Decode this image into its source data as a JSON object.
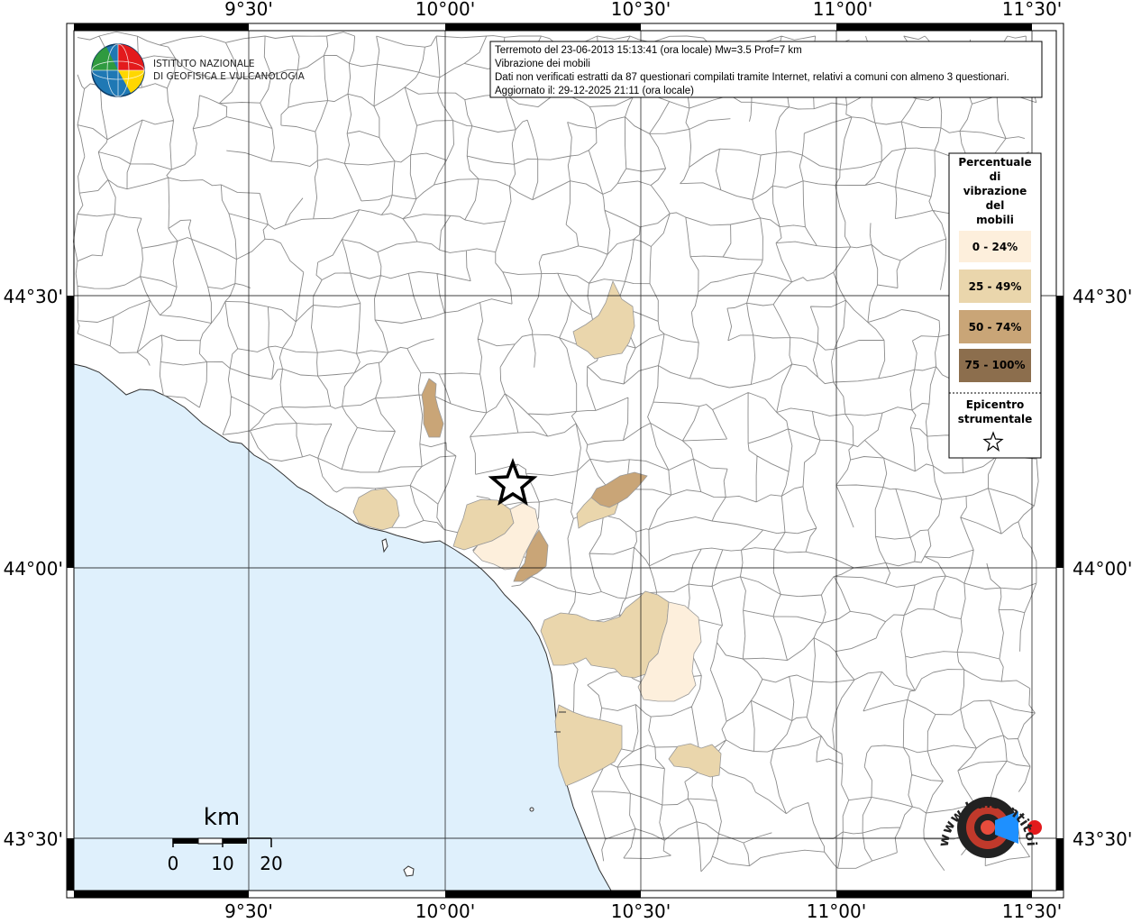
{
  "map": {
    "lon_labels": [
      "9°30'",
      "10°00'",
      "10°30'",
      "11°00'",
      "11°30'"
    ],
    "lat_labels": [
      "44°30'",
      "44°00'",
      "43°30'"
    ]
  },
  "info_box": {
    "line1": "Terremoto del 23-06-2013 15:13:41 (ora locale) Mw=3.5 Prof=7 km",
    "line2": "Vibrazione dei mobili",
    "line3": "Dati non verificati estratti da 87 questionari compilati tramite Internet, relativi a comuni con almeno 3 questionari.",
    "line4": "Aggiornato il: 29-12-2025 21:11 (ora locale)"
  },
  "legend": {
    "title_lines": [
      "Percentuale",
      "di",
      "vibrazione",
      "del",
      "mobili"
    ],
    "classes": [
      {
        "label": "0 - 24%",
        "color": "#fdefdc"
      },
      {
        "label": "25 - 49%",
        "color": "#ead6ac"
      },
      {
        "label": "50 - 74%",
        "color": "#c9a577"
      },
      {
        "label": "75 - 100%",
        "color": "#8c6e4d"
      }
    ],
    "epicenter_lines": [
      "Epicentro",
      "strumentale"
    ]
  },
  "scale": {
    "unit": "km",
    "ticks": [
      "0",
      "10",
      "20"
    ]
  },
  "logo": {
    "line1": "ISTITUTO NAZIONALE",
    "line2": "DI GEOFISICA E VULCANOLOGIA"
  },
  "badge": {
    "text": "www.haisentitoilterremoto.it"
  },
  "colors": {
    "sea": "#dff0fc",
    "land": "#ffffff",
    "c0": "#fdefdc",
    "c1": "#ead6ac",
    "c2": "#c9a577",
    "c3": "#8c6e4d"
  }
}
